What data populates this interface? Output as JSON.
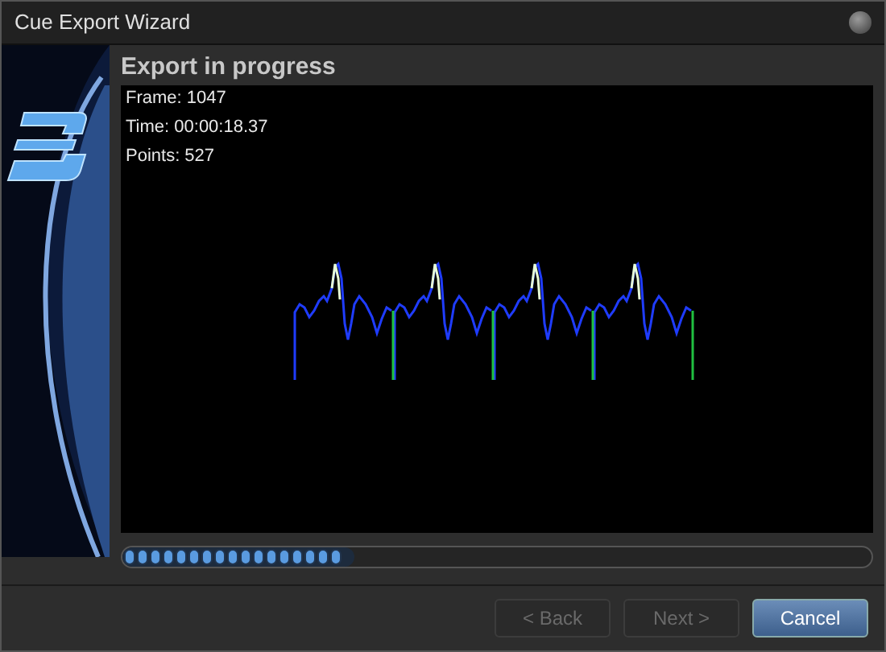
{
  "window": {
    "title": "Cue Export Wizard"
  },
  "heading": "Export in progress",
  "stats": [
    {
      "text": "Frame: 1047"
    },
    {
      "text": "Time: 00:00:18.37"
    },
    {
      "text": "Points: 527"
    }
  ],
  "progress": {
    "level": 0.31
  },
  "buttons": [
    {
      "label": "< Back",
      "default": false,
      "disabled": true
    },
    {
      "label": "Next >",
      "default": false,
      "disabled": true
    },
    {
      "label": "Cancel",
      "default": true,
      "disabled": false
    }
  ]
}
